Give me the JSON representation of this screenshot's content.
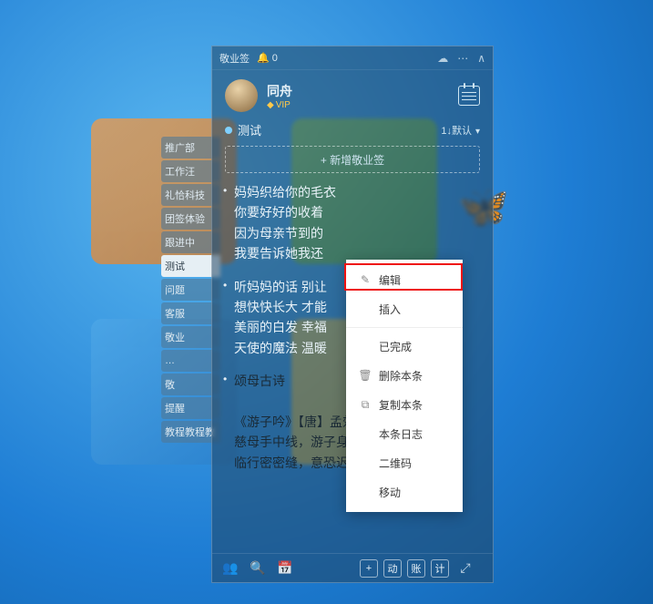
{
  "titlebar": {
    "appname": "敬业签",
    "bell_count": "0"
  },
  "header": {
    "username": "同舟",
    "vip_label": "VIP"
  },
  "category": {
    "name": "测试",
    "sort_label": "1↓默认"
  },
  "add_box": {
    "placeholder": "+ 新增敬业签"
  },
  "side_tabs": [
    {
      "label": "推广部"
    },
    {
      "label": "工作汪"
    },
    {
      "label": "礼恰科技"
    },
    {
      "label": "团签体验"
    },
    {
      "label": "跟进中"
    },
    {
      "label": "测试",
      "active": true
    },
    {
      "label": "问题"
    },
    {
      "label": "客服"
    },
    {
      "label": "敬业"
    },
    {
      "label": "…"
    },
    {
      "label": "敬"
    },
    {
      "label": "提醒"
    },
    {
      "label": "教程教程教"
    }
  ],
  "notes": [
    {
      "lines": [
        "妈妈织给你的毛衣",
        "你要好好的收着",
        "因为母亲节到的",
        "我要告诉她我还"
      ]
    },
    {
      "lines": [
        "听妈妈的话 别让",
        "想快快长大 才能",
        "美丽的白发 幸福",
        "天使的魔法 温暖"
      ]
    },
    {
      "lines": [
        "颂母古诗",
        "",
        "《游子吟》【唐】孟郊",
        "慈母手中线，游子身上衣。",
        "临行密密缝，意恐迟迟归。"
      ],
      "dark": true
    }
  ],
  "context_menu": {
    "items": [
      {
        "icon": "edit",
        "label": "编辑",
        "highlight": true
      },
      {
        "label": "插入"
      },
      {
        "sep": true
      },
      {
        "label": "已完成"
      },
      {
        "icon": "trash",
        "label": "删除本条"
      },
      {
        "icon": "copy",
        "label": "复制本条"
      },
      {
        "label": "本条日志"
      },
      {
        "label": "二维码"
      },
      {
        "label": "移动"
      }
    ]
  },
  "footer": {
    "chips": [
      "+",
      "动",
      "账",
      "计"
    ]
  }
}
